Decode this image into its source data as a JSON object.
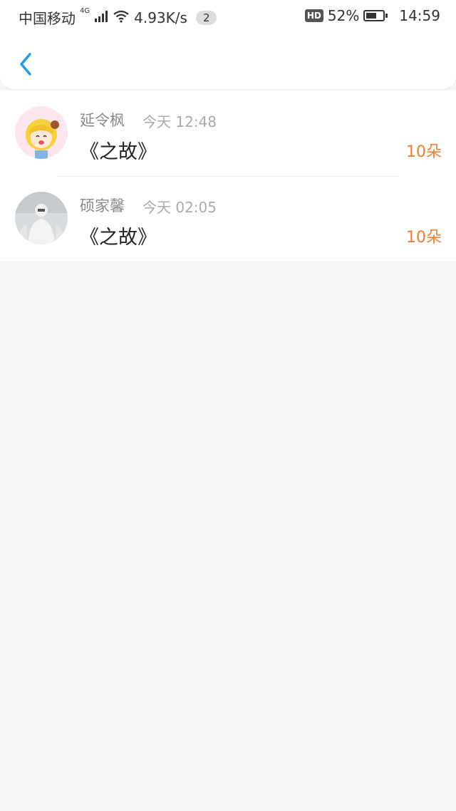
{
  "status_bar": {
    "carrier": "中国移动",
    "network": "4G",
    "speed": "4.93K/s",
    "notif_count": "2",
    "hd_label": "HD",
    "battery": "52%",
    "time": "14:59"
  },
  "header": {
    "back_icon": "chevron-left-icon"
  },
  "colors": {
    "accent_blue": "#1e9be9",
    "count_orange": "#f07d2e"
  },
  "items": [
    {
      "name": "延令枫",
      "time": "今天 12:48",
      "title": "《之故》",
      "count": "10朵"
    },
    {
      "name": "硕家馨",
      "time": "今天 02:05",
      "title": "《之故》",
      "count": "10朵"
    }
  ]
}
